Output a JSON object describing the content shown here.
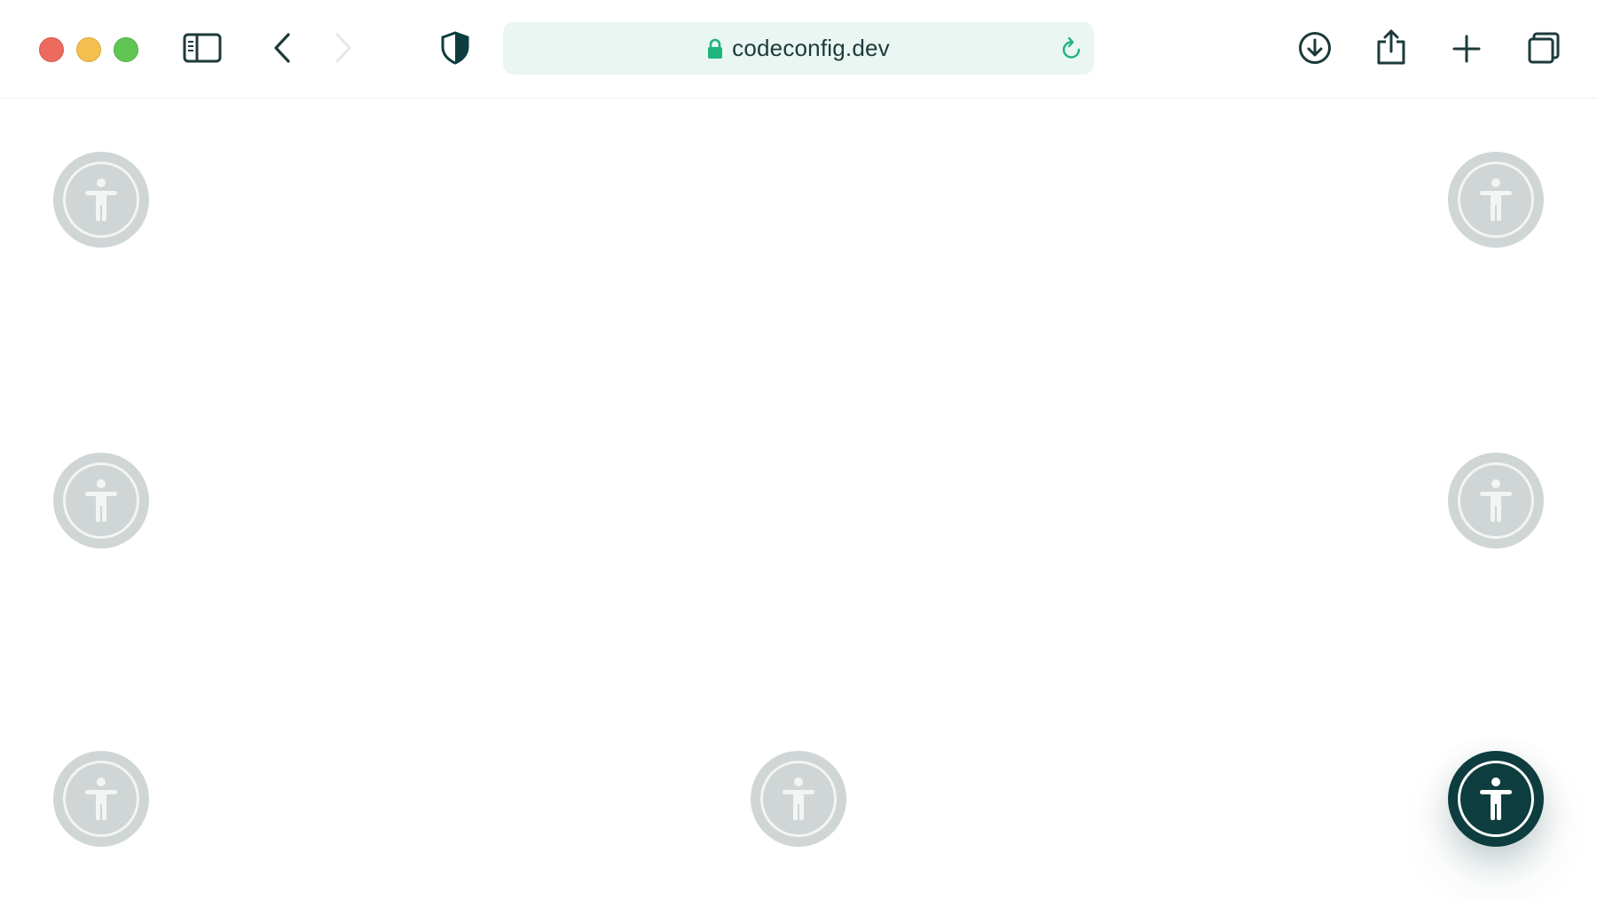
{
  "browser": {
    "url": "codeconfig.dev",
    "colors": {
      "close": "#ec6a5e",
      "minimize": "#f4bf4f",
      "maximize": "#61c554",
      "accent": "#1fb47e",
      "icon": "#1d3a3a",
      "url_bg": "#e9f6f1"
    },
    "toolbar_icons": [
      "sidebar-icon",
      "back-icon",
      "forward-icon",
      "shield-icon",
      "download-icon",
      "share-icon",
      "plus-icon",
      "tabs-icon"
    ]
  },
  "widgets": [
    {
      "name": "accessibility-button-top-left",
      "state": "inactive",
      "icon": "accessibility-icon"
    },
    {
      "name": "accessibility-button-top-right",
      "state": "inactive",
      "icon": "accessibility-icon"
    },
    {
      "name": "accessibility-button-middle-left",
      "state": "inactive",
      "icon": "accessibility-icon"
    },
    {
      "name": "accessibility-button-middle-right",
      "state": "inactive",
      "icon": "accessibility-icon"
    },
    {
      "name": "accessibility-button-bottom-left",
      "state": "inactive",
      "icon": "accessibility-icon"
    },
    {
      "name": "accessibility-button-bottom-center",
      "state": "inactive",
      "icon": "accessibility-icon"
    },
    {
      "name": "accessibility-button-bottom-right",
      "state": "active",
      "icon": "accessibility-icon"
    }
  ]
}
